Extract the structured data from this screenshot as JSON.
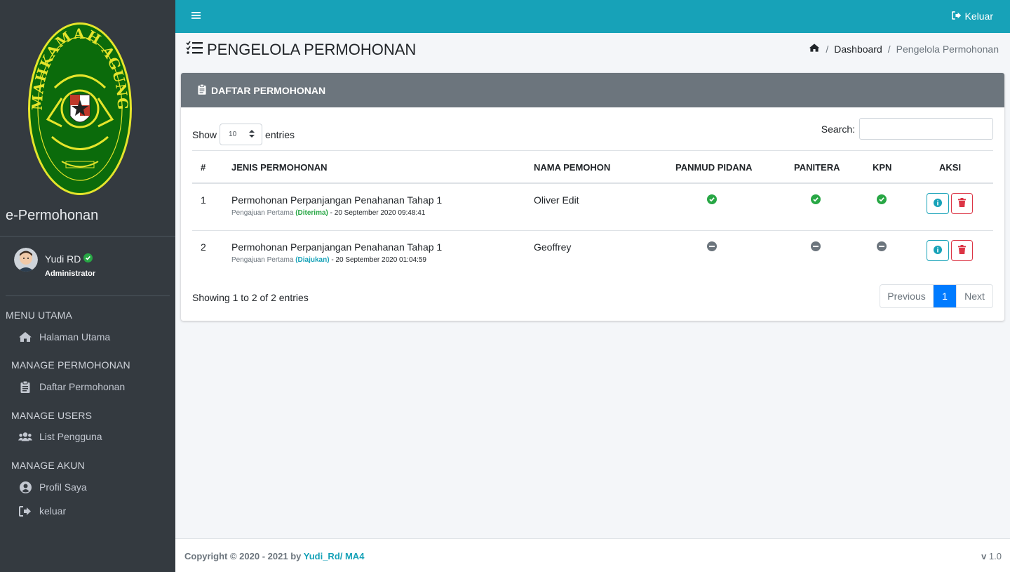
{
  "sidebar": {
    "brand": "e-Permohonan",
    "logo_text": "MAHKAMAH AGUNG",
    "user": {
      "name": "Yudi RD",
      "role": "Administrator"
    },
    "sections": [
      {
        "header": "MENU UTAMA",
        "items": [
          {
            "label": "Halaman Utama",
            "icon": "home-icon"
          }
        ]
      },
      {
        "header": "MANAGE PERMOHONAN",
        "items": [
          {
            "label": "Daftar Permohonan",
            "icon": "clipboard-icon"
          }
        ]
      },
      {
        "header": "MANAGE USERS",
        "items": [
          {
            "label": "List Pengguna",
            "icon": "users-icon"
          }
        ]
      },
      {
        "header": "MANAGE AKUN",
        "items": [
          {
            "label": "Profil Saya",
            "icon": "user-circle-icon"
          },
          {
            "label": "keluar",
            "icon": "sign-out-icon"
          }
        ]
      }
    ]
  },
  "topbar": {
    "logout_label": "Keluar"
  },
  "header": {
    "title": "PENGELOLA PERMOHONAN",
    "breadcrumb": {
      "dashboard": "Dashboard",
      "current": "Pengelola Permohonan"
    }
  },
  "card": {
    "title": "DAFTAR PERMOHONAN",
    "show_label": "Show",
    "entries_value": "10",
    "entries_label": "entries",
    "search_label": "Search:",
    "columns": [
      "#",
      "JENIS PERMOHONAN",
      "NAMA PEMOHON",
      "PANMUD PIDANA",
      "PANITERA",
      "KPN",
      "AKSI"
    ],
    "rows": [
      {
        "no": "1",
        "jenis": "Permohonan Perpanjangan Penahanan Tahap 1",
        "sub_prefix": "Pengajuan Pertama",
        "sub_status": "(Diterima)",
        "sub_date": "- 20 September 2020 09:48:41",
        "pemohon": "Oliver Edit",
        "panmud": "approved",
        "panitera": "approved",
        "kpn": "approved"
      },
      {
        "no": "2",
        "jenis": "Permohonan Perpanjangan Penahanan Tahap 1",
        "sub_prefix": "Pengajuan Pertama",
        "sub_status": "(Diajukan)",
        "sub_date": "- 20 September 2020 01:04:59",
        "pemohon": "Geoffrey",
        "panmud": "pending",
        "panitera": "pending",
        "kpn": "pending"
      }
    ],
    "showing_text": "Showing 1 to 2 of 2 entries",
    "pager": {
      "prev": "Previous",
      "current": "1",
      "next": "Next"
    }
  },
  "footer": {
    "copyright_prefix": "Copyright © 2020 - 2021 by",
    "author": "Yudi_Rd/ MA4",
    "version_label": "v",
    "version": "1.0"
  },
  "colors": {
    "sidebar": "#343a40",
    "topbar": "#17a2b8",
    "card_header": "#6c757d",
    "success": "#28a745",
    "danger": "#dc3545",
    "primary": "#007bff",
    "logo_green": "#0b6b0b",
    "logo_yellow": "#e5e52b"
  }
}
